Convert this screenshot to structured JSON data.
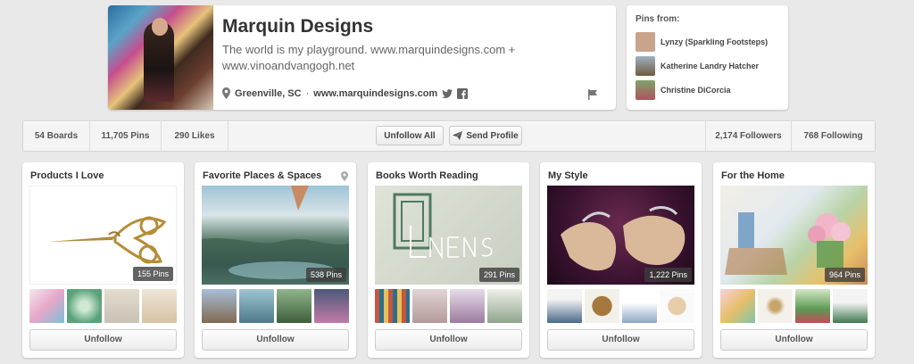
{
  "profile": {
    "name": "Marquin Designs",
    "bio": "The world is my playground. www.marquindesigns.com + www.vinoandvangogh.net",
    "location": "Greenville, SC",
    "separator": "·",
    "website": "www.marquindesigns.com"
  },
  "pins_from": {
    "title": "Pins from:",
    "items": [
      {
        "name": "Lynzy (Sparkling Footsteps)",
        "color": "#c9a48c"
      },
      {
        "name": "Katherine Landry Hatcher",
        "color": "#8a7b4a"
      },
      {
        "name": "Christine DiCorcia",
        "color": "#6d8a56"
      }
    ]
  },
  "stats": {
    "boards": "54 Boards",
    "pins": "11,705 Pins",
    "likes": "290 Likes",
    "followers": "2,174 Followers",
    "following": "768 Following"
  },
  "actions": {
    "unfollow_all": "Unfollow All",
    "send_profile": "Send Profile"
  },
  "boards": [
    {
      "title": "Products I Love",
      "pin_count": "155 Pins",
      "unfollow": "Unfollow",
      "thumb_colors": [
        "#e6a7c8",
        "#5aa37a",
        "#c9c2b3",
        "#d6c2a4"
      ]
    },
    {
      "title": "Favorite Places & Spaces",
      "pin_count": "538 Pins",
      "unfollow": "Unfollow",
      "thumb_colors": [
        "#7f6a52",
        "#4d7a88",
        "#5b7c4d",
        "#2c3a52"
      ]
    },
    {
      "title": "Books Worth Reading",
      "pin_count": "291 Pins",
      "unfollow": "Unfollow",
      "thumb_colors": [
        "#c4573f",
        "#b49a9a",
        "#9c7b9e",
        "#8fa58c"
      ]
    },
    {
      "title": "My Style",
      "pin_count": "1,222 Pins",
      "unfollow": "Unfollow",
      "thumb_colors": [
        "#4a6a8a",
        "#a5793e",
        "#8fa6c6",
        "#e7cda9"
      ]
    },
    {
      "title": "For the Home",
      "pin_count": "964 Pins",
      "unfollow": "Unfollow",
      "thumb_colors": [
        "#e8c06a",
        "#dcd6c4",
        "#5b9a52",
        "#3f7a4e"
      ]
    }
  ],
  "colors": {
    "background": "#e9e9e9",
    "card": "#ffffff",
    "text_primary": "#333333",
    "text_secondary": "#666666"
  }
}
